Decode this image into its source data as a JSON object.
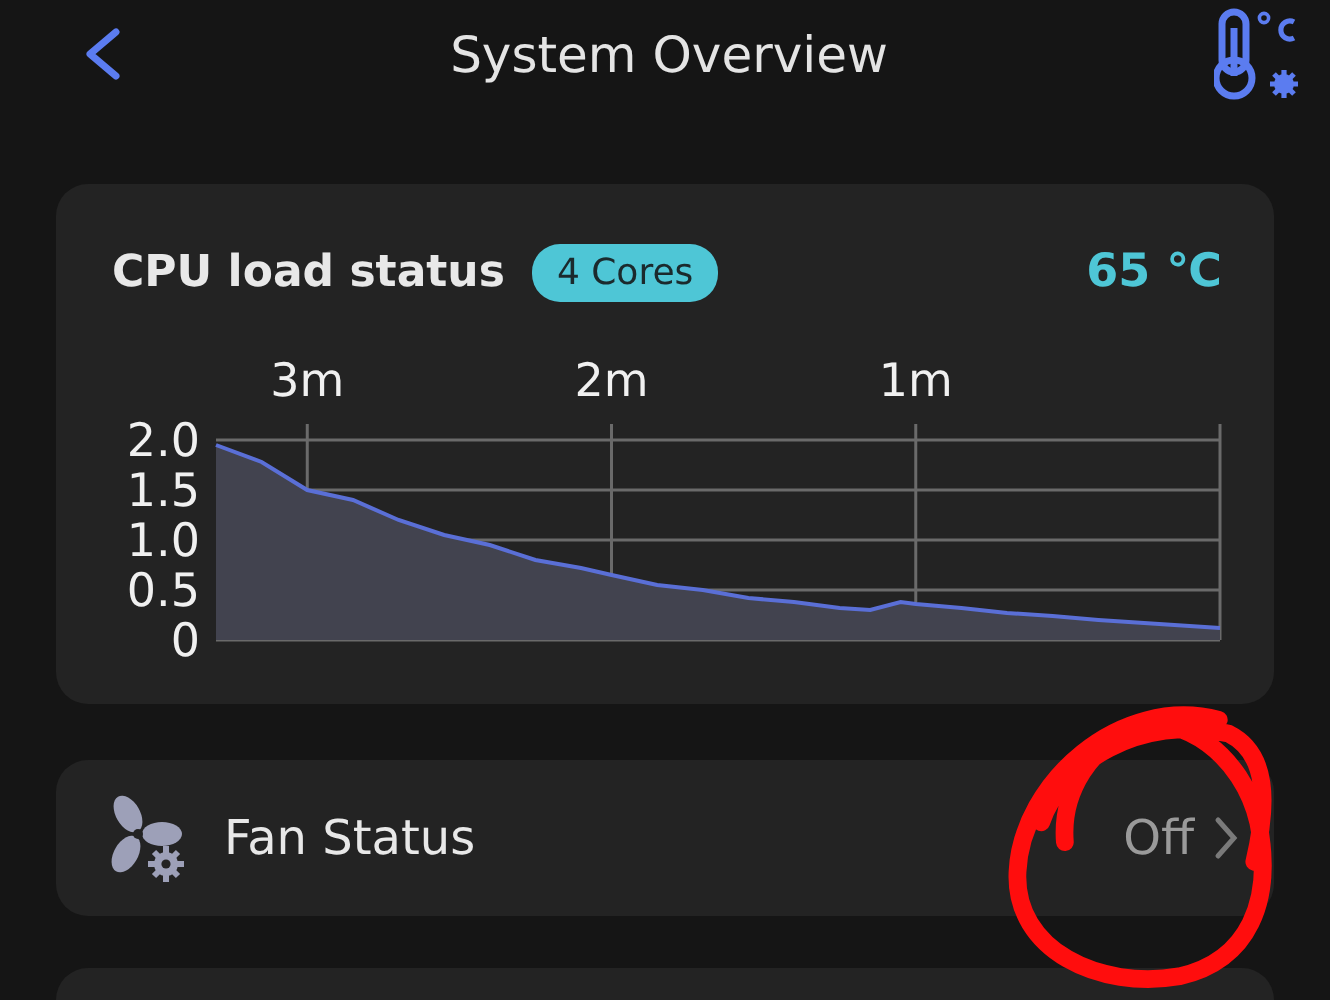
{
  "header": {
    "title": "System Overview"
  },
  "cpu_card": {
    "title": "CPU load status",
    "badge": "4 Cores",
    "temperature": "65 ℃",
    "chart_data": {
      "type": "area",
      "x": [
        3.3,
        3.15,
        3.0,
        2.85,
        2.7,
        2.55,
        2.4,
        2.25,
        2.1,
        2.0,
        1.85,
        1.7,
        1.55,
        1.4,
        1.25,
        1.15,
        1.05,
        1.0,
        0.85,
        0.7,
        0.55,
        0.4,
        0.25,
        0.1,
        0.0
      ],
      "values": [
        1.95,
        1.78,
        1.5,
        1.4,
        1.2,
        1.05,
        0.95,
        0.8,
        0.72,
        0.65,
        0.55,
        0.5,
        0.42,
        0.38,
        0.32,
        0.3,
        0.38,
        0.36,
        0.32,
        0.27,
        0.24,
        0.2,
        0.17,
        0.14,
        0.12
      ],
      "grid": true,
      "xlim": [
        3.3,
        0
      ],
      "ylim": [
        0,
        2
      ],
      "xticks": [
        {
          "value": 3,
          "label": "3m"
        },
        {
          "value": 2,
          "label": "2m"
        },
        {
          "value": 1,
          "label": "1m"
        }
      ],
      "yticks": [
        {
          "value": 0,
          "label": "0"
        },
        {
          "value": 0.5,
          "label": "0.5"
        },
        {
          "value": 1,
          "label": "1.0"
        },
        {
          "value": 1.5,
          "label": "1.5"
        },
        {
          "value": 2,
          "label": "2.0"
        }
      ]
    }
  },
  "fan_row": {
    "label": "Fan Status",
    "value": "Off"
  }
}
